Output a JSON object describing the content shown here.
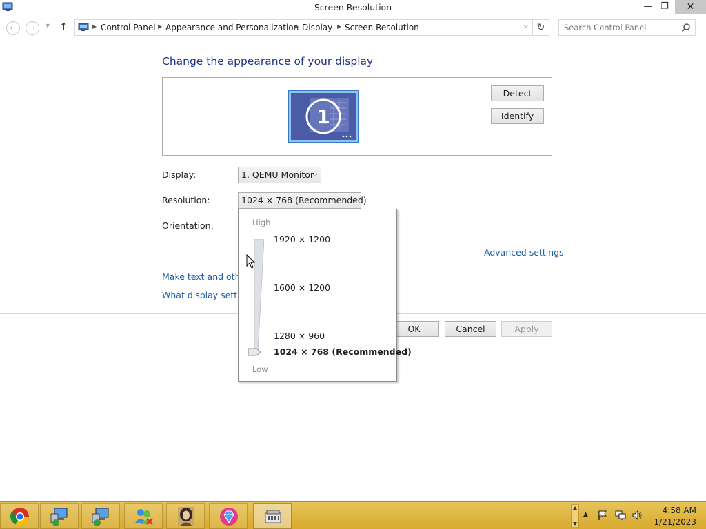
{
  "window": {
    "title": "Screen Resolution",
    "controls": {
      "minimize": "—",
      "maximize": "❐",
      "close": "✕"
    }
  },
  "address_bar": {
    "breadcrumbs": [
      "Control Panel",
      "Appearance and Personalization",
      "Display",
      "Screen Resolution"
    ],
    "search_placeholder": "Search Control Panel"
  },
  "main": {
    "heading": "Change the appearance of your display",
    "monitor_number": "1",
    "detect_label": "Detect",
    "identify_label": "Identify",
    "display_label": "Display:",
    "display_value": "1. QEMU Monitor",
    "resolution_label": "Resolution:",
    "resolution_value": "1024 × 768 (Recommended)",
    "orientation_label": "Orientation:",
    "advanced_settings": "Advanced settings",
    "link_text_size": "Make text and other",
    "link_display_settings": "What display settin",
    "ok_label": "OK",
    "cancel_label": "Cancel",
    "apply_label": "Apply"
  },
  "resolution_dropdown": {
    "high_label": "High",
    "low_label": "Low",
    "options": [
      "1920 × 1200",
      "1600 × 1200",
      "1280 × 960",
      "1024 × 768 (Recommended)"
    ],
    "selected_index": 3
  },
  "taskbar": {
    "items": [
      "chrome-icon",
      "network-computer-icon",
      "network-computer-icon",
      "user-accounts-icon",
      "portrait-icon",
      "gem-icon",
      "screen-resolution-icon"
    ],
    "active_index": 6,
    "time": "4:58 AM",
    "date": "1/21/2023"
  },
  "colors": {
    "heading": "#1e3287",
    "link": "#1b5ea6",
    "taskbar": "#d8aa2e",
    "monitor_screen": "#4a5ba8"
  }
}
